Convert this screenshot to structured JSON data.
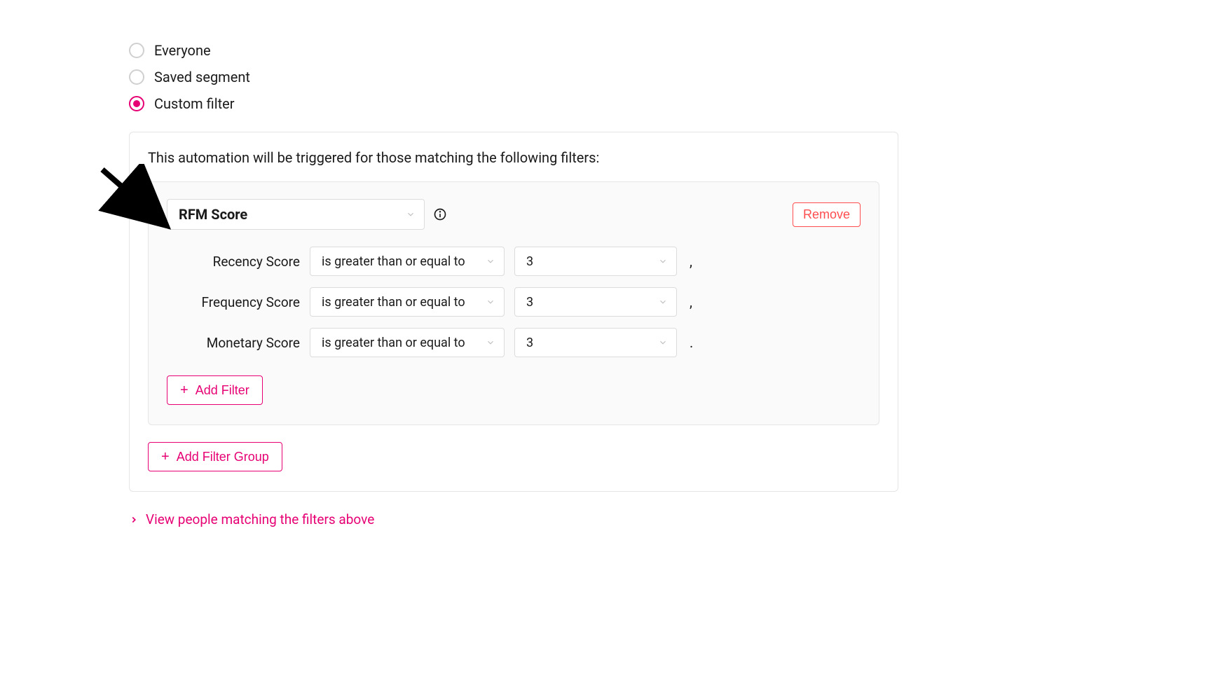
{
  "radios": {
    "everyone": "Everyone",
    "saved_segment": "Saved segment",
    "custom_filter": "Custom filter"
  },
  "intro": "This automation will be triggered for those matching the following filters:",
  "filter_group": {
    "main_select": "RFM Score",
    "remove_label": "Remove",
    "rows": [
      {
        "label": "Recency Score",
        "op": "is greater than or equal to",
        "value": "3",
        "punct": ","
      },
      {
        "label": "Frequency Score",
        "op": "is greater than or equal to",
        "value": "3",
        "punct": ","
      },
      {
        "label": "Monetary Score",
        "op": "is greater than or equal to",
        "value": "3",
        "punct": "."
      }
    ],
    "add_filter_label": "Add Filter"
  },
  "add_filter_group_label": "Add Filter Group",
  "view_link_label": "View people matching the filters above",
  "colors": {
    "accent": "#e60073",
    "danger": "#ff4d4f",
    "border": "#e5e5e5"
  }
}
